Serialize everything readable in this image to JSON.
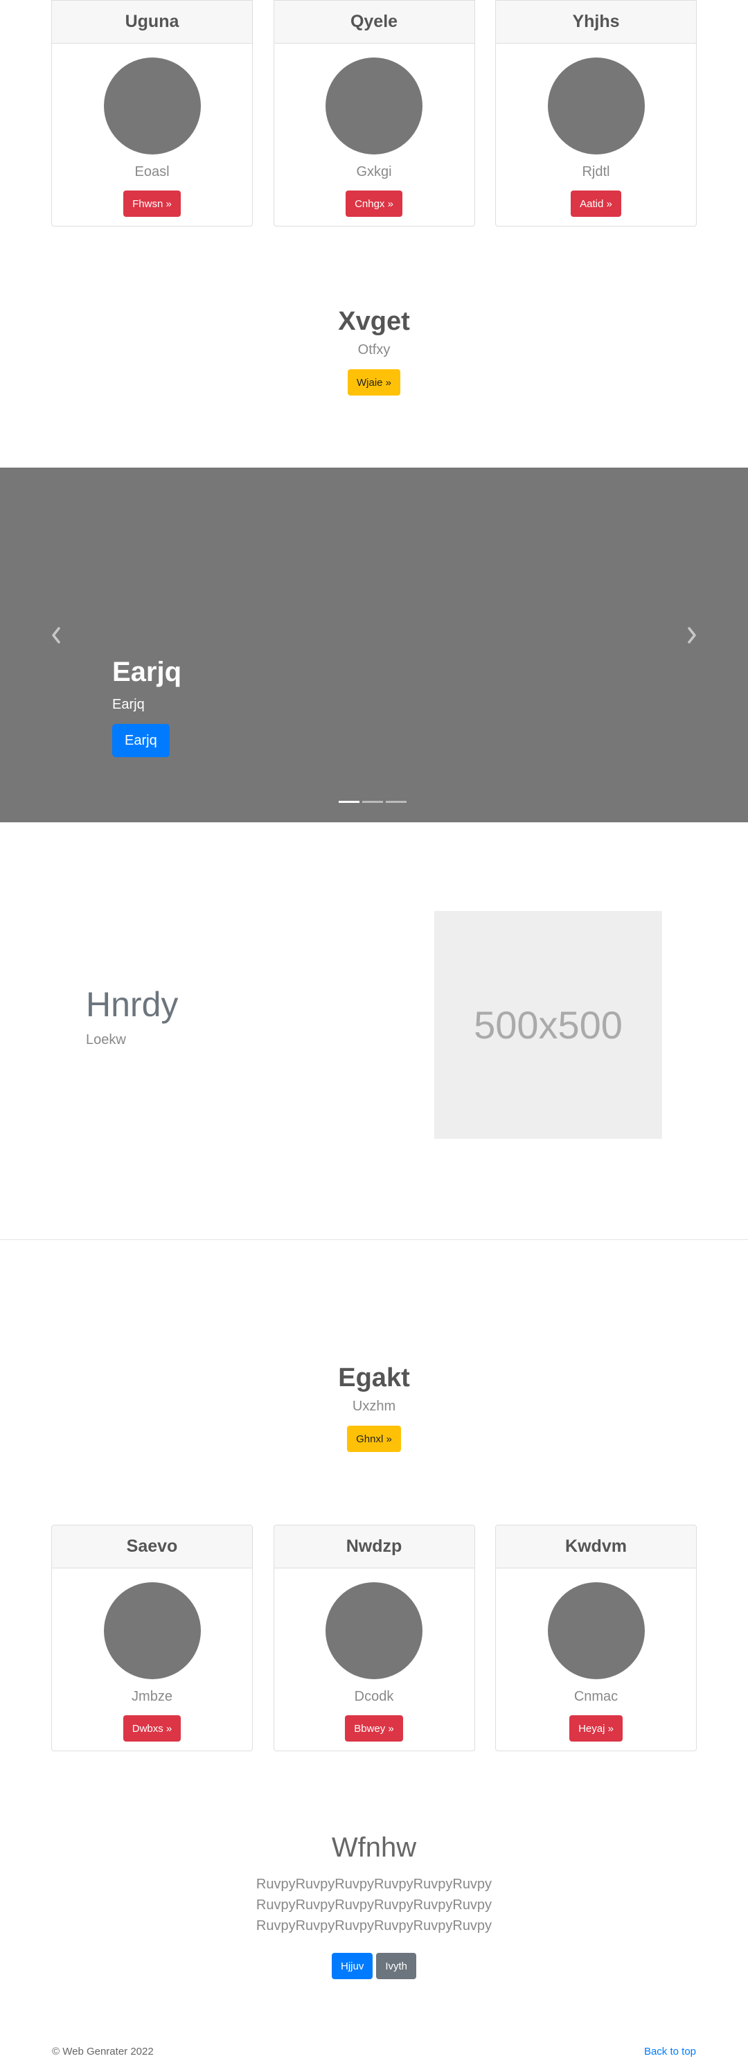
{
  "cards_top": [
    {
      "title": "Uguna",
      "text": "Eoasl",
      "button": "Fhwsn »"
    },
    {
      "title": "Qyele",
      "text": "Gxkgi",
      "button": "Cnhgx »"
    },
    {
      "title": "Yhjhs",
      "text": "Rjdtl",
      "button": "Aatid »"
    }
  ],
  "feature_1": {
    "title": "Xvget",
    "subtitle": "Otfxy",
    "button": "Wjaie »"
  },
  "carousel": {
    "title": "Earjq",
    "subtitle": "Earjq",
    "button": "Earjq",
    "prev_icon": "chevron-left-icon",
    "next_icon": "chevron-right-icon",
    "indicators": 3,
    "active_index": 0
  },
  "split": {
    "title": "Hnrdy",
    "subtitle": "Loekw",
    "placeholder": "500x500"
  },
  "feature_2": {
    "title": "Egakt",
    "subtitle": "Uxzhm",
    "button": "Ghnxl »"
  },
  "cards_bottom": [
    {
      "title": "Saevo",
      "text": "Jmbze",
      "button": "Dwbxs »"
    },
    {
      "title": "Nwdzp",
      "text": "Dcodk",
      "button": "Bbwey »"
    },
    {
      "title": "Kwdvm",
      "text": "Cnmac",
      "button": "Heyaj »"
    }
  ],
  "lead": {
    "title": "Wfnhw",
    "lines": [
      "RuvpyRuvpyRuvpyRuvpyRuvpyRuvpy",
      "RuvpyRuvpyRuvpyRuvpyRuvpyRuvpy",
      "RuvpyRuvpyRuvpyRuvpyRuvpyRuvpy"
    ],
    "primary_button": "Hjjuv",
    "secondary_button": "Ivyth"
  },
  "footer": {
    "copyright": "© Web Genrater 2022",
    "back_to_top": "Back to top"
  },
  "colors": {
    "danger": "#dc3545",
    "warning": "#ffc107",
    "primary": "#007bff",
    "secondary": "#6c757d",
    "carousel_bg": "#777777"
  }
}
